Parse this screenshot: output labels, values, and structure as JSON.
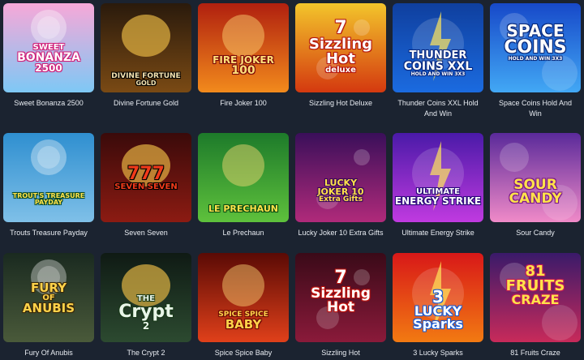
{
  "games": [
    {
      "title": "Sweet Bonanza 2500",
      "logo": [
        "SWEET",
        "BONANZA",
        "2500"
      ],
      "colors": [
        "#f7a8d8",
        "#7ec8f5"
      ],
      "icon": "lollipop-icon"
    },
    {
      "title": "Divine Fortune Gold",
      "logo": [
        "DIVINE FORTUNE",
        "GOLD"
      ],
      "colors": [
        "#2a1a0c",
        "#7a4a14"
      ],
      "icon": "golden-urn-icon"
    },
    {
      "title": "Fire Joker 100",
      "logo": [
        "FIRE JOKER",
        "100"
      ],
      "colors": [
        "#b0200f",
        "#f28a1c"
      ],
      "icon": "joker-face-icon"
    },
    {
      "title": "Sizzling Hot Deluxe",
      "logo": [
        "7",
        "Sizzling",
        "Hot",
        "deluxe"
      ],
      "colors": [
        "#f3c52b",
        "#d4390f"
      ],
      "icon": "seven-cherry-icon"
    },
    {
      "title": "Thunder Coins XXL Hold And Win",
      "logo": [
        "THUNDER",
        "COINS XXL",
        "HOLD AND WIN 3X3"
      ],
      "colors": [
        "#0f3f9e",
        "#1b6be0"
      ],
      "icon": "lightning-coin-icon"
    },
    {
      "title": "Space Coins Hold And Win",
      "logo": [
        "SPACE",
        "COINS",
        "HOLD AND WIN 3X3"
      ],
      "colors": [
        "#1749c9",
        "#42a8f5"
      ],
      "icon": "space-coin-icon"
    },
    {
      "title": "Trouts Treasure Payday",
      "logo": [
        "TROUT'S TREASURE",
        "PAYDAY"
      ],
      "colors": [
        "#2f8fd0",
        "#7fc0e8"
      ],
      "icon": "fisherman-icon"
    },
    {
      "title": "Seven Seven",
      "logo": [
        "777",
        "SEVEN SEVEN"
      ],
      "colors": [
        "#3a0a0a",
        "#8c1b12"
      ],
      "icon": "sevens-icon"
    },
    {
      "title": "Le Prechaun",
      "logo": [
        "LE PRECHAUN"
      ],
      "colors": [
        "#1d7a2a",
        "#5ec13c"
      ],
      "icon": "leprechaun-raccoon-icon"
    },
    {
      "title": "Lucky Joker 10 Extra Gifts",
      "logo": [
        "LUCKY",
        "JOKER 10",
        "Extra Gifts"
      ],
      "colors": [
        "#3a0f5a",
        "#b02a7a"
      ],
      "icon": "jester-lady-icon"
    },
    {
      "title": "Ultimate Energy Strike",
      "logo": [
        "ULTIMATE",
        "ENERGY STRIKE"
      ],
      "colors": [
        "#4a1aa8",
        "#c03ae0"
      ],
      "icon": "energy-orb-icon"
    },
    {
      "title": "Sour Candy",
      "logo": [
        "SOUR",
        "CANDY"
      ],
      "colors": [
        "#5a2a9a",
        "#f08ac8"
      ],
      "icon": "candy-ball-icon"
    },
    {
      "title": "Fury Of Anubis",
      "logo": [
        "FURY",
        "OF",
        "ANUBIS"
      ],
      "colors": [
        "#1a2a20",
        "#4a5a3a"
      ],
      "icon": "anubis-icon"
    },
    {
      "title": "The Crypt 2",
      "logo": [
        "THE",
        "Crypt",
        "2"
      ],
      "colors": [
        "#0f1a14",
        "#2c4a30"
      ],
      "icon": "skeleton-icon"
    },
    {
      "title": "Spice Spice Baby",
      "logo": [
        "SPICE SPICE",
        "BABY"
      ],
      "colors": [
        "#5a0a05",
        "#e0401a"
      ],
      "icon": "chili-pepper-icon"
    },
    {
      "title": "Sizzling Hot",
      "logo": [
        "7",
        "Sizzling",
        "Hot"
      ],
      "colors": [
        "#3a0a18",
        "#8a1a3a"
      ],
      "icon": "seven-fruits-icon"
    },
    {
      "title": "3 Lucky Sparks",
      "logo": [
        "3",
        "LUCKY",
        "Sparks"
      ],
      "colors": [
        "#d81818",
        "#f27a12"
      ],
      "icon": "sparks-icon"
    },
    {
      "title": "81 Fruits Craze",
      "logo": [
        "81",
        "FRUITS",
        "CRAZE"
      ],
      "colors": [
        "#3a1a6a",
        "#c82a5a"
      ],
      "icon": "fruit-basket-icon"
    }
  ]
}
